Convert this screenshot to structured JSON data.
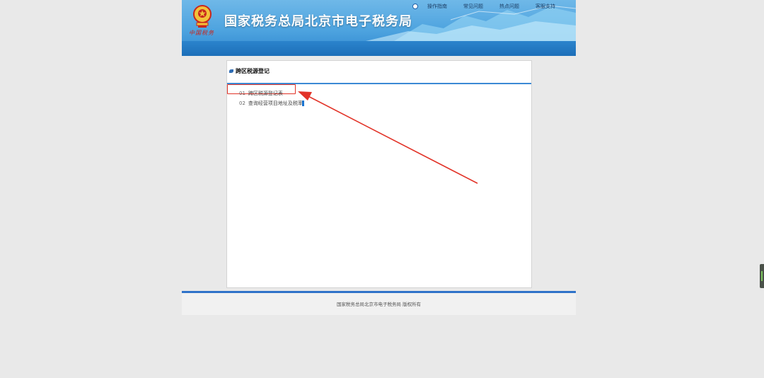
{
  "header": {
    "site_title": "国家税务总局北京市电子税务局",
    "brand_script": "中国税务",
    "nav": [
      "操作指南",
      "常见问题",
      "热点问题",
      "客服支持"
    ]
  },
  "card": {
    "title": "跨区税源登记",
    "items": [
      {
        "num": "01",
        "label": "跨区税源登记表"
      },
      {
        "num": "02",
        "label": "查询经营项目地址及税率"
      }
    ]
  },
  "footer": {
    "text": "国家税务总局北京市电子税务局  版权所有"
  },
  "colors": {
    "accent_blue": "#2f73c9",
    "highlight_red": "#e23328",
    "header_blue": "#4da3df"
  }
}
